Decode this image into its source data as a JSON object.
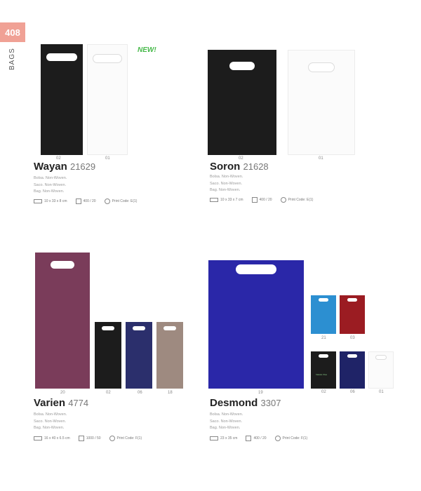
{
  "page": {
    "number": "408",
    "section": "BAGS"
  },
  "new_badge": "NEW!",
  "products": [
    {
      "name": "Wayan",
      "ref": "21629",
      "desc": [
        "Bolsa. Non-Woven.",
        "Saco. Non-Woven.",
        "Bag. Non-Woven."
      ],
      "size": "10 x 33 x 8 cm",
      "pack": "400 / 20",
      "print": "Print Code: E(1)",
      "codes": [
        "02",
        "01"
      ]
    },
    {
      "name": "Soron",
      "ref": "21628",
      "desc": [
        "Bolsa. Non-Woven.",
        "Saco. Non-Woven.",
        "Bag. Non-Woven."
      ],
      "size": "10 x 33 x 7 cm",
      "pack": "400 / 20",
      "print": "Print Code: E(1)",
      "codes": [
        "02",
        "01"
      ]
    },
    {
      "name": "Varien",
      "ref": "4774",
      "desc": [
        "Bolsa. Non-Woven.",
        "Saco. Non-Woven.",
        "Bag. Non-Woven."
      ],
      "size": "16 x 40 x 6.5 cm",
      "pack": "1000 / 50",
      "print": "Print Code: F(1)",
      "codes": [
        "20",
        "02",
        "06",
        "18"
      ]
    },
    {
      "name": "Desmond",
      "ref": "3307",
      "desc": [
        "Bolsa. Non-Woven.",
        "Saco. Non-Woven.",
        "Bag. Non-Woven."
      ],
      "size": "23 x 35 cm",
      "pack": "400 / 20",
      "print": "Print Code: F(1)",
      "codes": [
        "19",
        "21",
        "03",
        "02",
        "06",
        "01"
      ]
    }
  ],
  "logo_text": "Natura Viva",
  "colors": {
    "black": "#1c1c1c",
    "white": "#ffffff",
    "burgundy": "#7a3c5a",
    "navy": "#2b2f6c",
    "taupe": "#9e8a80",
    "royal_blue": "#2a27a8",
    "light_blue": "#2c8fd1",
    "red": "#9b1c22",
    "accent_green": "#47b94a"
  }
}
